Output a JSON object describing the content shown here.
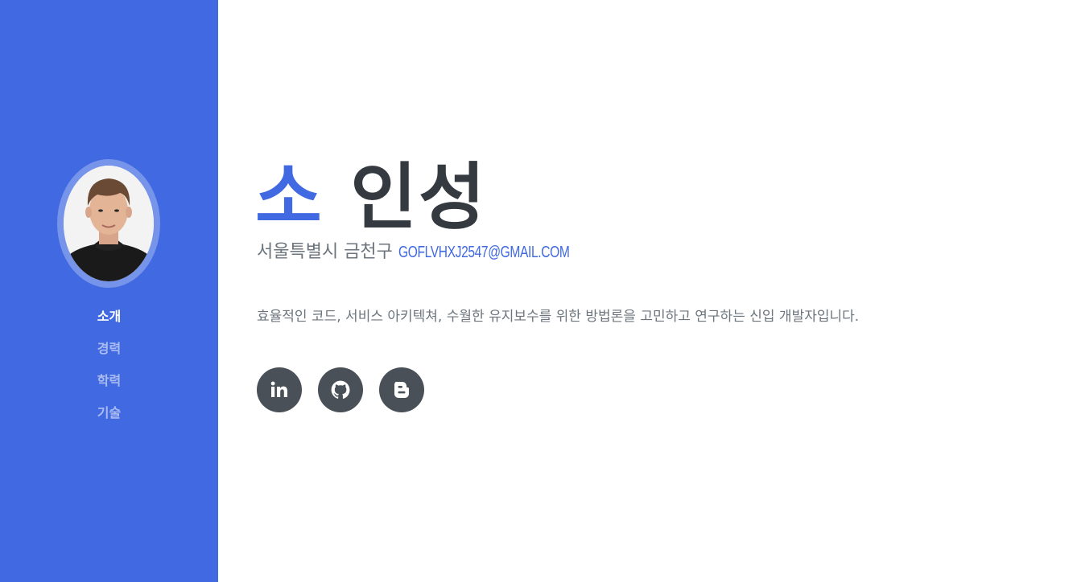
{
  "nav": {
    "items": [
      {
        "label": "소개",
        "active": true
      },
      {
        "label": "경력",
        "active": false
      },
      {
        "label": "학력",
        "active": false
      },
      {
        "label": "기술",
        "active": false
      }
    ]
  },
  "profile": {
    "first_name": "소",
    "last_name": "인성",
    "location": "서울특별시 금천구",
    "email": "GOFLVHXJ2547@GMAIL.COM",
    "intro": "효율적인 코드, 서비스 아키텍쳐, 수월한 유지보수를 위한 방법론을 고민하고 연구하는 신입 개발자입니다."
  },
  "social": [
    {
      "icon": "linkedin-icon"
    },
    {
      "icon": "github-icon"
    },
    {
      "icon": "blogger-icon"
    }
  ],
  "colors": {
    "accent": "#4169e1",
    "heading": "#343a40",
    "muted": "#6c757d",
    "social_bg": "#495057"
  }
}
